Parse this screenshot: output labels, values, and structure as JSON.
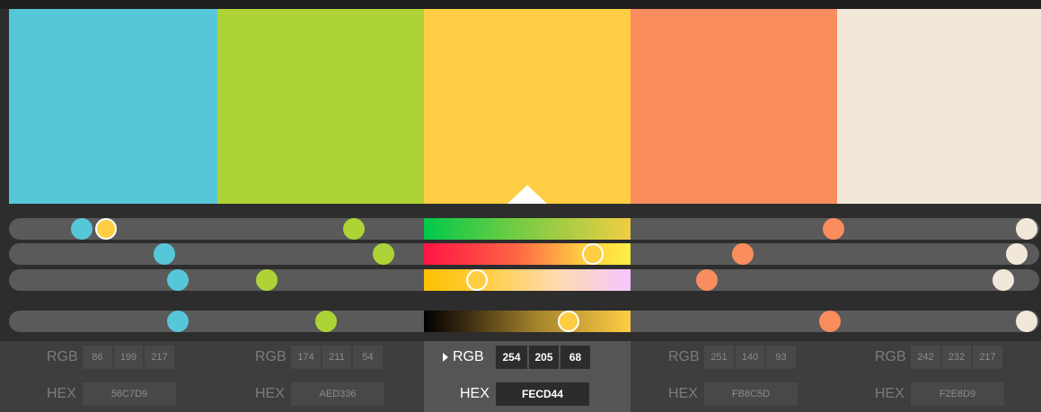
{
  "colors": [
    {
      "hex_label": "56C7D9",
      "rgb": [
        "86",
        "199",
        "217"
      ],
      "color": "#56C7D9"
    },
    {
      "hex_label": "AED336",
      "rgb": [
        "174",
        "211",
        "54"
      ],
      "color": "#AED336"
    },
    {
      "hex_label": "FECD44",
      "rgb": [
        "254",
        "205",
        "68"
      ],
      "color": "#FECD44"
    },
    {
      "hex_label": "FB8C5D",
      "rgb": [
        "251",
        "140",
        "93"
      ],
      "color": "#FB8C5D"
    },
    {
      "hex_label": "F2E8D9",
      "rgb": [
        "242",
        "232",
        "217"
      ],
      "color": "#F2E8D9"
    }
  ],
  "labels": {
    "rgb": "RGB",
    "hex": "HEX"
  },
  "active_index": 2,
  "sliders": [
    {
      "name": "hue",
      "knob_fraction": [
        0.0706,
        0.3352,
        0.0943,
        0.8004,
        0.9878
      ],
      "gradient": "linear-gradient(90deg,#00c84a 0%,#68cc44 40%,#f0cd44 100%)"
    },
    {
      "name": "saturation",
      "knob_fraction": [
        0.1506,
        0.3637,
        0.5665,
        0.7119,
        0.9785
      ],
      "gradient": "linear-gradient(90deg,#fe1444 0%,#fe6644 45%,#fec844 75%,#fef044 100%)"
    },
    {
      "name": "brightness",
      "knob_fraction": [
        0.1642,
        0.2505,
        0.4538,
        0.6774,
        0.9654
      ],
      "gradient": "linear-gradient(90deg,#fec000 0%,#fecd44 30%,#fedab0 65%,#f5c6ff 100%)"
    },
    {
      "name": "lightness",
      "knob_fraction": [
        0.1642,
        0.3081,
        0.5435,
        0.7972,
        0.9878
      ],
      "gradient": "linear-gradient(90deg,#000000 0%,#3a2a10 20%,#a5842c 55%,#fecd44 100%)"
    }
  ]
}
